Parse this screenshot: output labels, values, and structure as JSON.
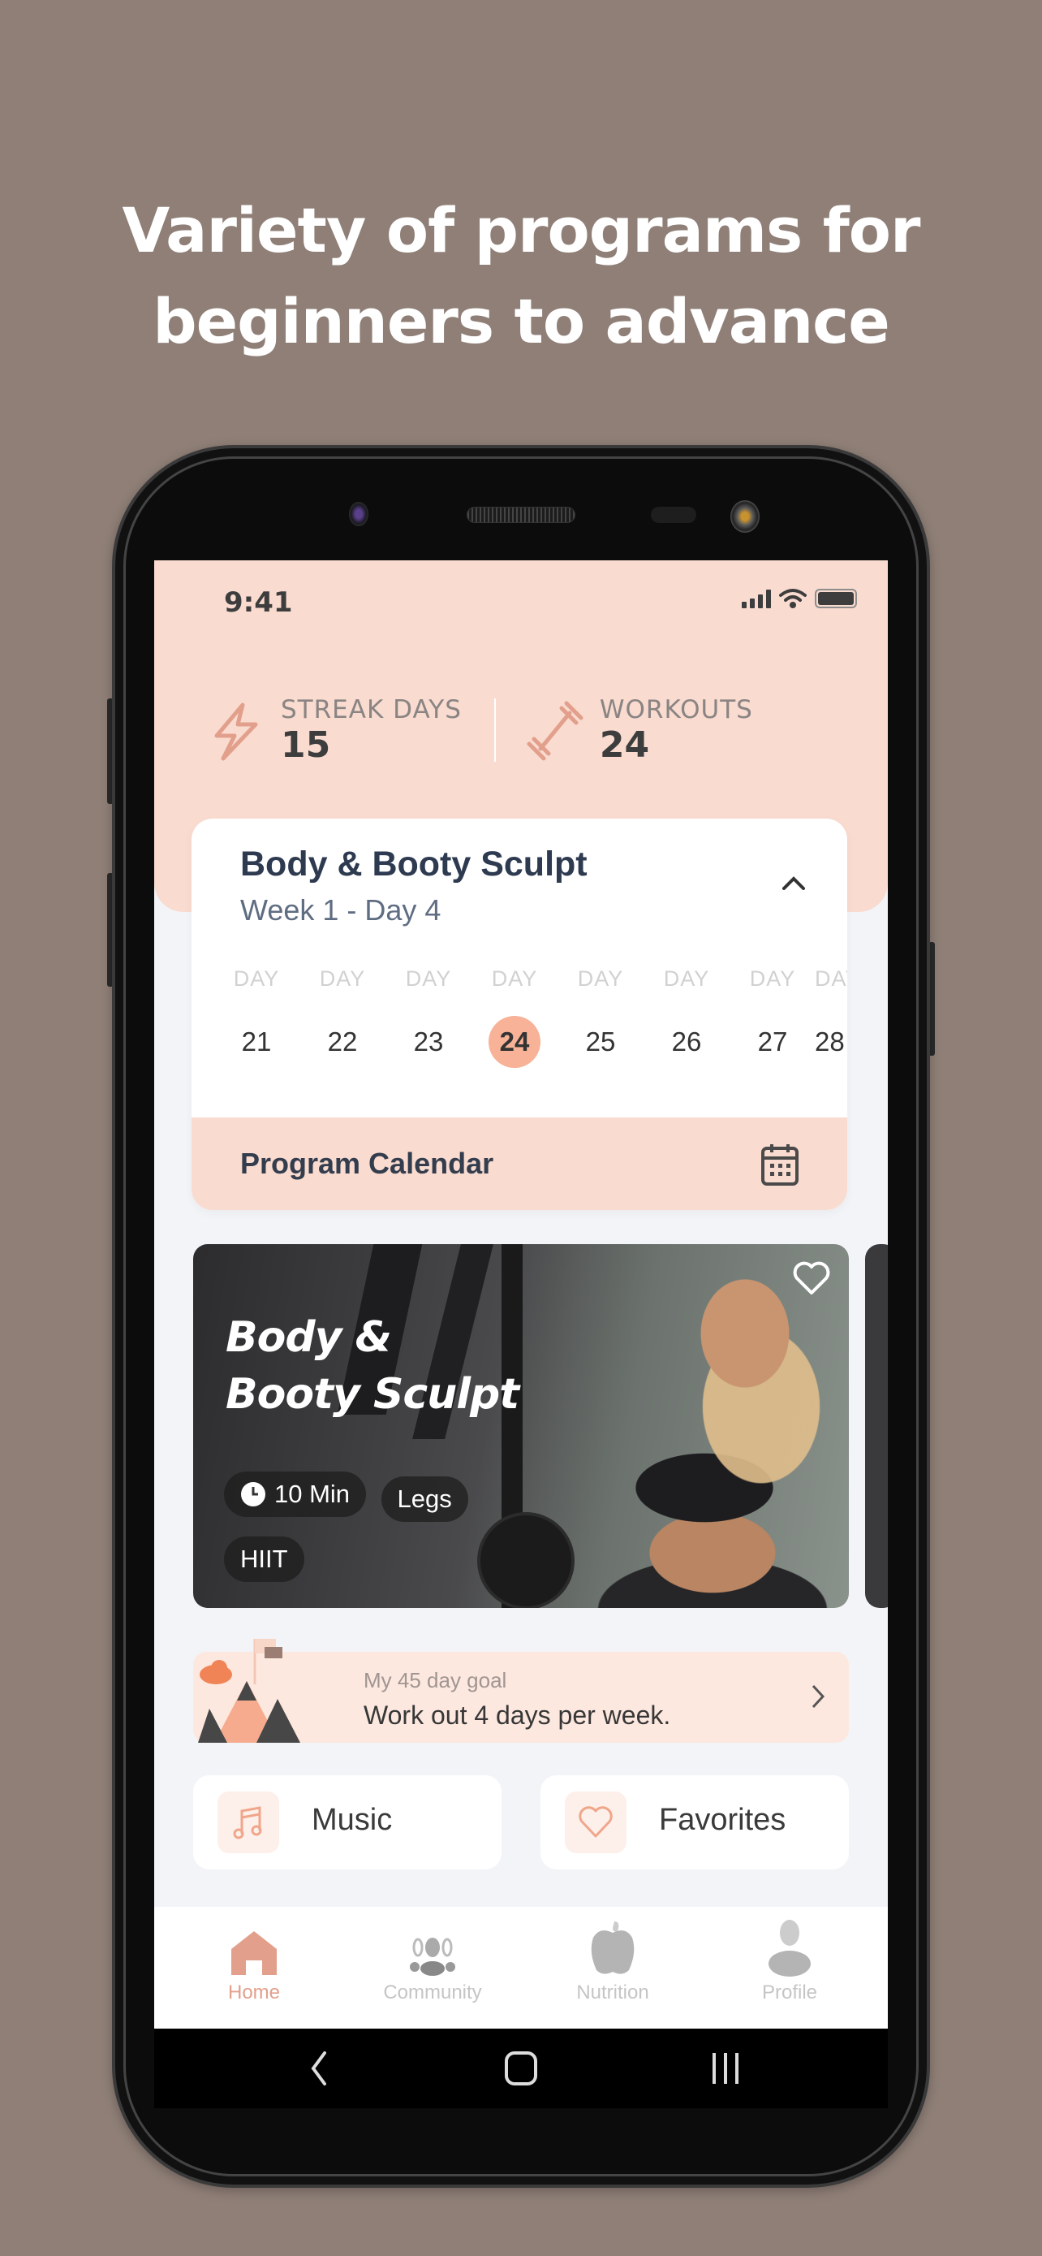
{
  "headline": {
    "line1": "Variety of programs for",
    "line2": "beginners to advance"
  },
  "status_bar": {
    "time": "9:41",
    "icons": [
      "signal-icon",
      "wifi-icon",
      "battery-icon"
    ]
  },
  "stats": [
    {
      "icon": "lightning-icon",
      "label": "STREAK DAYS",
      "value": "15"
    },
    {
      "icon": "dumbbell-icon",
      "label": "WORKOUTS",
      "value": "24"
    }
  ],
  "program": {
    "title": "Body & Booty Sculpt",
    "subtitle": "Week 1 - Day 4",
    "collapse_icon": "chevron-up-icon",
    "day_label": "DAY",
    "days": [
      "21",
      "22",
      "23",
      "24",
      "25",
      "26",
      "27",
      "28"
    ],
    "active_day": "24",
    "footer_label": "Program Calendar",
    "footer_icon": "calendar-icon"
  },
  "workout_card": {
    "title_line1": "Body &",
    "title_line2": "Booty Sculpt",
    "tags": [
      "10 Min",
      "Legs",
      "HIIT"
    ],
    "duration_icon": "clock-icon",
    "favorite_icon": "heart-outline-icon"
  },
  "goal": {
    "label": "My 45 day goal",
    "text": "Work out 4 days per week.",
    "icon": "mountain-flag-icon"
  },
  "quick_links": [
    {
      "label": "Music",
      "icon": "music-note-icon"
    },
    {
      "label": "Favorites",
      "icon": "heart-icon"
    }
  ],
  "tabs": [
    {
      "label": "Home",
      "icon": "home-icon",
      "active": true
    },
    {
      "label": "Community",
      "icon": "community-icon",
      "active": false
    },
    {
      "label": "Nutrition",
      "icon": "apple-icon",
      "active": false
    },
    {
      "label": "Profile",
      "icon": "profile-icon",
      "active": false
    }
  ],
  "system_nav": [
    "back-icon",
    "home-button-icon",
    "recents-icon"
  ],
  "colors": {
    "accent": "#f7b297",
    "accent_bg": "#f9dbd0",
    "icon_accent": "#e2a08c",
    "text_dark": "#2e3a50",
    "page_bg": "#8f7f77"
  }
}
